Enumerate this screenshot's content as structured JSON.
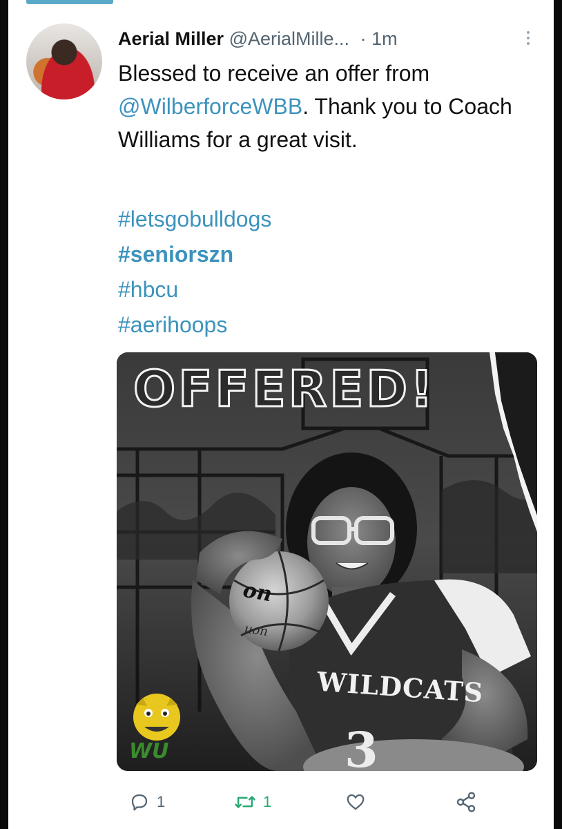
{
  "tweet": {
    "author_name": "Aerial Miller",
    "author_handle": "@AerialMille...",
    "separator": "·",
    "timestamp": "1m",
    "text_part1": "Blessed to receive an offer from ",
    "mention": "@WilberforceWBB",
    "text_part2": ". Thank you to Coach Williams for a great visit.",
    "hashtags": [
      {
        "text": "#letsgobulldogs",
        "bold": false
      },
      {
        "text": "#seniorszn",
        "bold": true
      },
      {
        "text": "#hbcu",
        "bold": false
      },
      {
        "text": "#aerihoops",
        "bold": false
      }
    ]
  },
  "media": {
    "title": "OFFERED!",
    "jersey_text": "WILDCATS",
    "ball_brand": "on",
    "ball_brand_small": "uon",
    "logo_letters": "WU"
  },
  "actions": {
    "reply_count": "1",
    "retweet_count": "1"
  },
  "colors": {
    "link": "#3d93bd",
    "retweet_active": "#2aa872",
    "muted": "#536471"
  }
}
